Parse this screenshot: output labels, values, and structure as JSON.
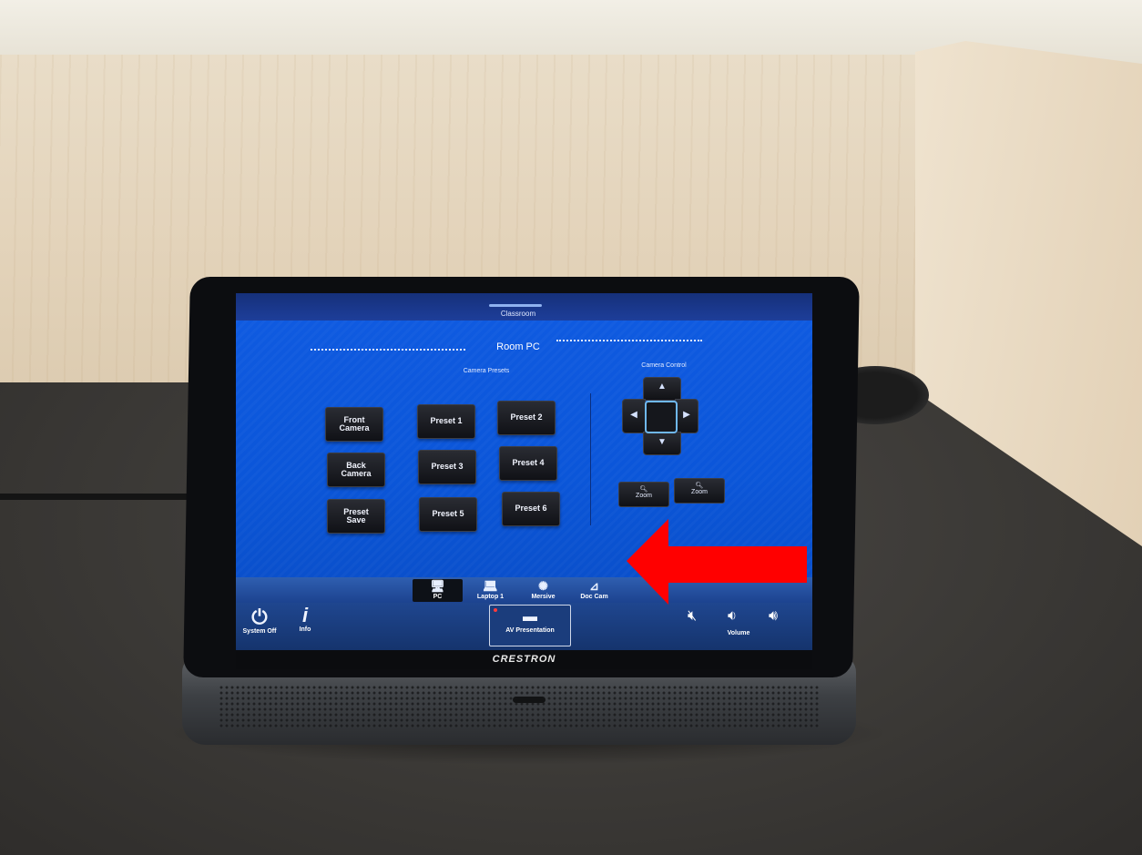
{
  "panel": {
    "page_tab": "Classroom",
    "title": "Room PC",
    "camera_presets_label": "Camera Presets",
    "camera_control_label": "Camera Control",
    "buttons": {
      "front_camera": "Front\nCamera",
      "back_camera": "Back\nCamera",
      "preset_save": "Preset\nSave",
      "preset_1": "Preset 1",
      "preset_2": "Preset 2",
      "preset_3": "Preset 3",
      "preset_4": "Preset 4",
      "preset_5": "Preset 5",
      "preset_6": "Preset 6"
    },
    "zoom_out_label": "Zoom",
    "zoom_in_label": "Zoom",
    "sources": [
      {
        "label": "PC",
        "icon": "desktop-pc-icon",
        "active": true
      },
      {
        "label": "Laptop 1",
        "icon": "laptop-icon",
        "active": false
      },
      {
        "label": "Mersive",
        "icon": "mersive-icon",
        "active": false
      },
      {
        "label": "Doc Cam",
        "icon": "document-camera-icon",
        "active": false
      }
    ],
    "bottom": {
      "system_off": "System Off",
      "info": "Info",
      "av_presentation": "AV Presentation",
      "volume": "Volume"
    },
    "brand": "CRESTRON"
  },
  "colors": {
    "screen_blue": "#0b56d9",
    "button_dark": "#15171c",
    "arrow_red": "#ff0000"
  }
}
